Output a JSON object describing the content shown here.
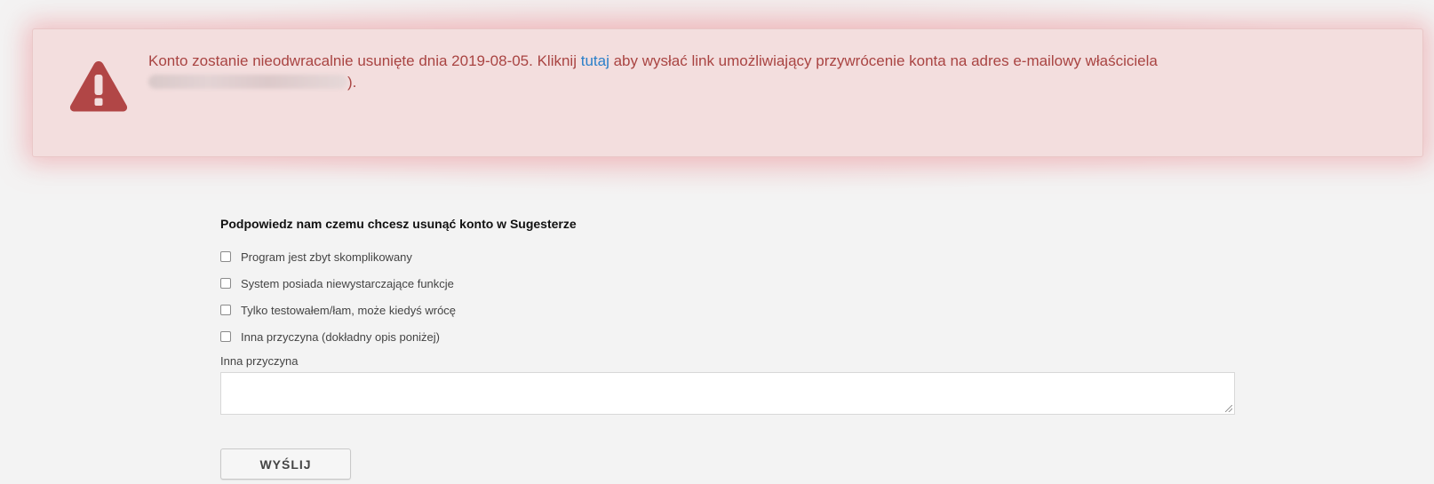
{
  "alert": {
    "text_before_link": "Konto zostanie nieodwracalnie usunięte dnia 2019-08-05. Kliknij ",
    "link_text": "tutaj",
    "text_after_link": " aby wysłać link umożliwiający przywrócenie konta na adres e-mailowy właściciela ",
    "text_end": ").",
    "icon": "warning-triangle-icon",
    "colors": {
      "background": "#f3dede",
      "text": "#a94442",
      "icon": "#b14646",
      "link": "#2a7fc9"
    }
  },
  "form": {
    "title": "Podpowiedz nam czemu chcesz usunąć konto w Sugesterze",
    "reasons": [
      {
        "label": "Program jest zbyt skomplikowany",
        "checked": false
      },
      {
        "label": "System posiada niewystarczające funkcje",
        "checked": false
      },
      {
        "label": "Tylko testowałem/łam, może kiedyś wrócę",
        "checked": false
      },
      {
        "label": "Inna przyczyna (dokładny opis poniżej)",
        "checked": false
      }
    ],
    "other_reason_label": "Inna przyczyna",
    "other_reason_value": "",
    "submit_label": "WYŚLIJ"
  }
}
